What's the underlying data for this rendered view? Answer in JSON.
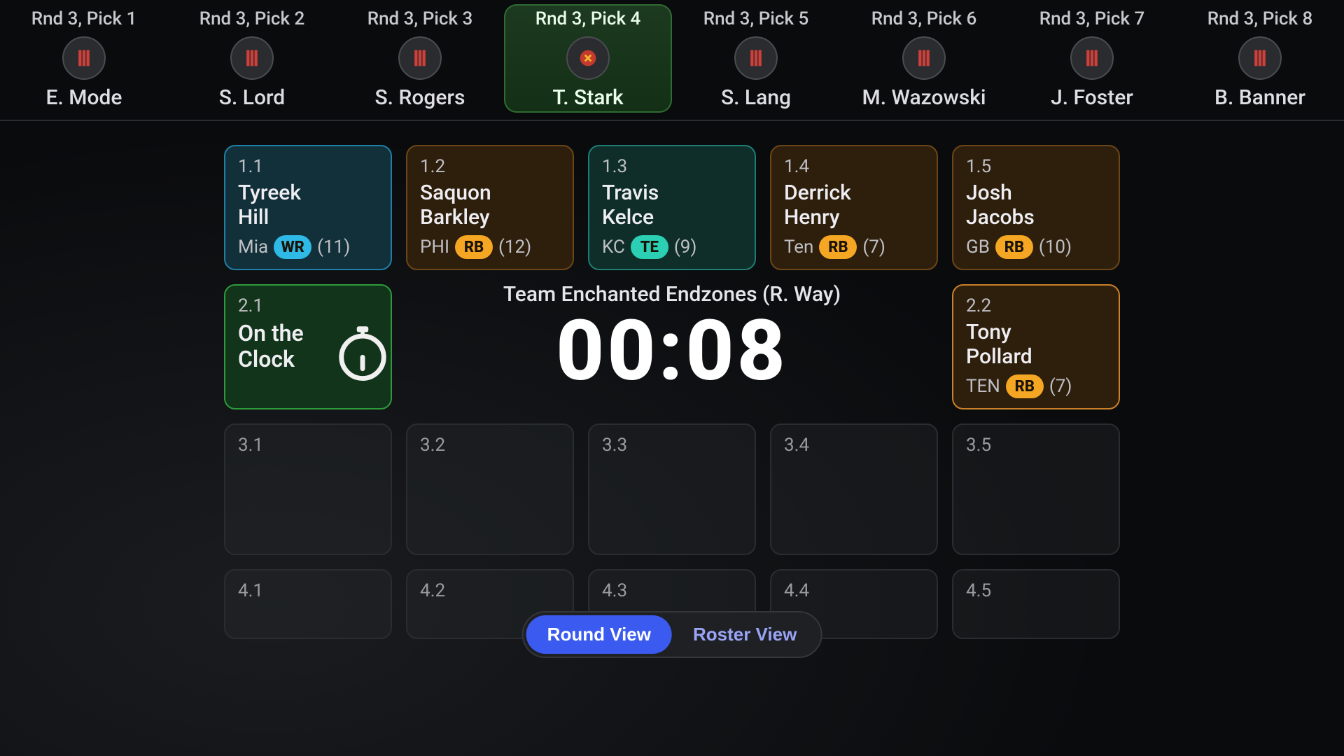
{
  "pick_strip": {
    "slots": [
      {
        "label": "Rnd 3, Pick 1",
        "manager": "E. Mode",
        "active": false
      },
      {
        "label": "Rnd 3, Pick 2",
        "manager": "S. Lord",
        "active": false
      },
      {
        "label": "Rnd 3, Pick 3",
        "manager": "S. Rogers",
        "active": false
      },
      {
        "label": "Rnd 3, Pick 4",
        "manager": "T. Stark",
        "active": true
      },
      {
        "label": "Rnd 3, Pick 5",
        "manager": "S. Lang",
        "active": false
      },
      {
        "label": "Rnd 3, Pick 6",
        "manager": "M. Wazowski",
        "active": false
      },
      {
        "label": "Rnd 3, Pick 7",
        "manager": "J. Foster",
        "active": false
      },
      {
        "label": "Rnd 3, Pick 8",
        "manager": "B. Banner",
        "active": false
      }
    ]
  },
  "timer": {
    "team_label": "Team Enchanted Endzones (R. Way)",
    "value": "00:08"
  },
  "board": {
    "row1": [
      {
        "slot": "1.1",
        "first": "Tyreek",
        "last": "Hill",
        "team": "Mia",
        "pos": "WR",
        "bye": "(11)",
        "theme": "cyan"
      },
      {
        "slot": "1.2",
        "first": "Saquon",
        "last": "Barkley",
        "team": "PHI",
        "pos": "RB",
        "bye": "(12)",
        "theme": "orange"
      },
      {
        "slot": "1.3",
        "first": "Travis",
        "last": "Kelce",
        "team": "KC",
        "pos": "TE",
        "bye": "(9)",
        "theme": "teal"
      },
      {
        "slot": "1.4",
        "first": "Derrick",
        "last": "Henry",
        "team": "Ten",
        "pos": "RB",
        "bye": "(7)",
        "theme": "orange"
      },
      {
        "slot": "1.5",
        "first": "Josh",
        "last": "Jacobs",
        "team": "GB",
        "pos": "RB",
        "bye": "(10)",
        "theme": "orange"
      }
    ],
    "row2_clock": {
      "slot": "2.1",
      "line1": "On the",
      "line2": "Clock",
      "theme": "green"
    },
    "row2_pollard": {
      "slot": "2.2",
      "first": "Tony",
      "last": "Pollard",
      "team": "TEN",
      "pos": "RB",
      "bye": "(7)",
      "theme": "amber"
    },
    "row3": [
      {
        "slot": "3.1"
      },
      {
        "slot": "3.2"
      },
      {
        "slot": "3.3"
      },
      {
        "slot": "3.4"
      },
      {
        "slot": "3.5"
      }
    ],
    "row4": [
      {
        "slot": "4.1"
      },
      {
        "slot": "4.2"
      },
      {
        "slot": "4.3"
      },
      {
        "slot": "4.4"
      },
      {
        "slot": "4.5"
      }
    ]
  },
  "view_toggle": {
    "round_label": "Round View",
    "roster_label": "Roster View",
    "active": "round"
  },
  "colors": {
    "accent_blue": "#3b5bf0",
    "pos_wr": "#2fb9e6",
    "pos_rb": "#f5a623",
    "pos_te": "#2bd0b4"
  }
}
